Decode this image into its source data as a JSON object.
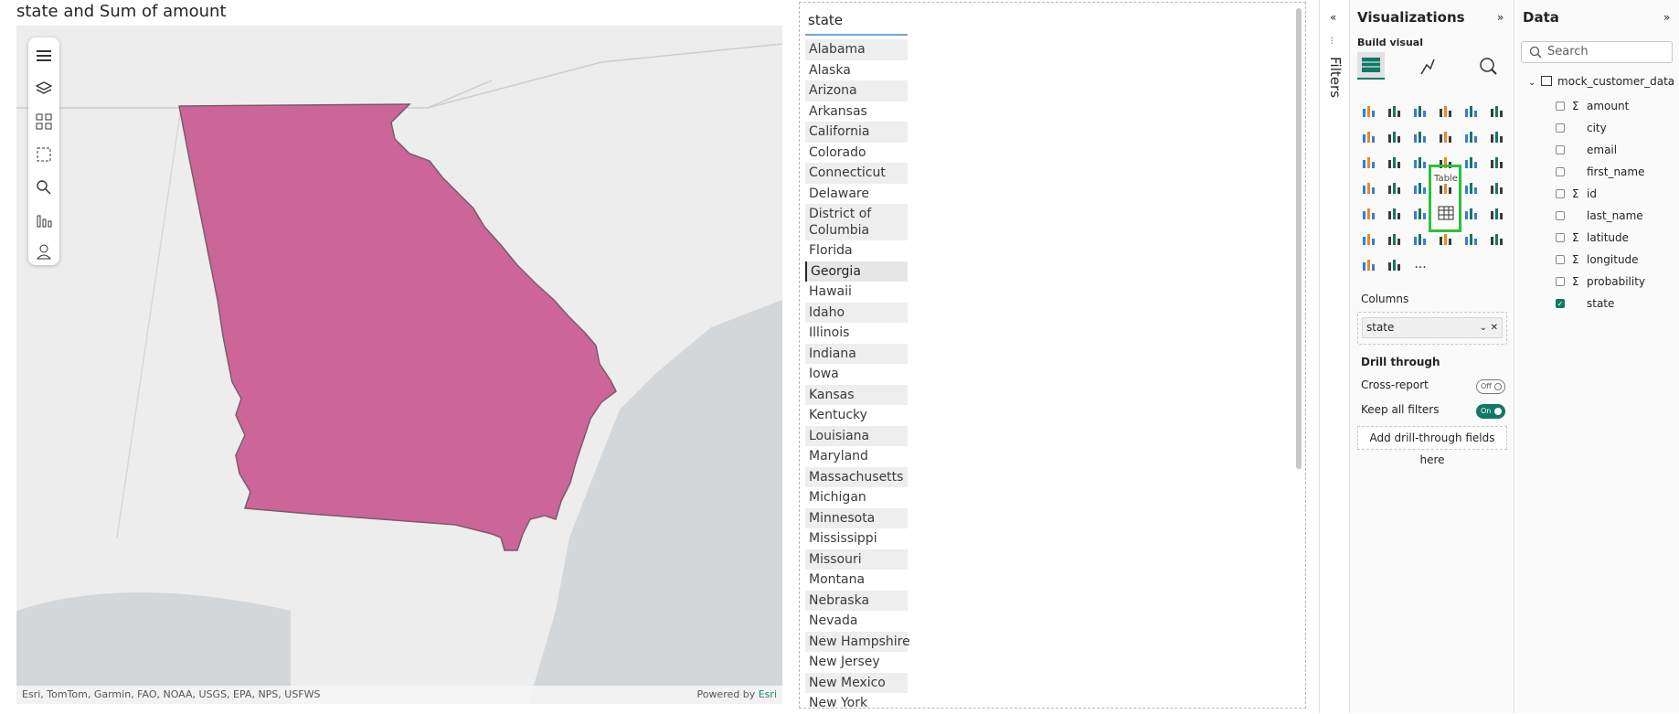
{
  "map": {
    "title": "state and Sum of amount",
    "attribution_left": "Esri, TomTom, Garmin, FAO, NOAA, USGS, EPA, NPS, USFWS",
    "attribution_right_prefix": "Powered by",
    "attribution_right_link": "Esri",
    "highlighted_state": "Georgia",
    "fill_color": "#cc6699"
  },
  "table": {
    "header": "state",
    "rows": [
      "Alabama",
      "Alaska",
      "Arizona",
      "Arkansas",
      "California",
      "Colorado",
      "Connecticut",
      "Delaware",
      "District of Columbia",
      "Florida",
      "Georgia",
      "Hawaii",
      "Idaho",
      "Illinois",
      "Indiana",
      "Iowa",
      "Kansas",
      "Kentucky",
      "Louisiana",
      "Maryland",
      "Massachusetts",
      "Michigan",
      "Minnesota",
      "Mississippi",
      "Missouri",
      "Montana",
      "Nebraska",
      "Nevada",
      "New Hampshire",
      "New Jersey",
      "New Mexico",
      "New York"
    ],
    "selected": "Georgia"
  },
  "filters": {
    "label": "Filters"
  },
  "visualizations": {
    "title": "Visualizations",
    "build_visual": "Build visual",
    "tooltip": "Table",
    "columns_label": "Columns",
    "column_field": "state",
    "drill_through": "Drill through",
    "cross_report": "Cross-report",
    "cross_report_state": "Off",
    "keep_all_filters": "Keep all filters",
    "keep_all_filters_state": "On",
    "add_drill": "Add drill-through fields here",
    "more": "..."
  },
  "data_pane": {
    "title": "Data",
    "search_placeholder": "Search",
    "table_name": "mock_customer_data",
    "fields": [
      {
        "name": "amount",
        "sigma": true,
        "checked": false
      },
      {
        "name": "city",
        "sigma": false,
        "checked": false
      },
      {
        "name": "email",
        "sigma": false,
        "checked": false
      },
      {
        "name": "first_name",
        "sigma": false,
        "checked": false
      },
      {
        "name": "id",
        "sigma": true,
        "checked": false
      },
      {
        "name": "last_name",
        "sigma": false,
        "checked": false
      },
      {
        "name": "latitude",
        "sigma": true,
        "checked": false
      },
      {
        "name": "longitude",
        "sigma": true,
        "checked": false
      },
      {
        "name": "probability",
        "sigma": true,
        "checked": false
      },
      {
        "name": "state",
        "sigma": false,
        "checked": true
      }
    ]
  },
  "colors": {
    "accent": "#117865",
    "highlight_box": "#29c23c",
    "map_fill": "#cc6699"
  }
}
